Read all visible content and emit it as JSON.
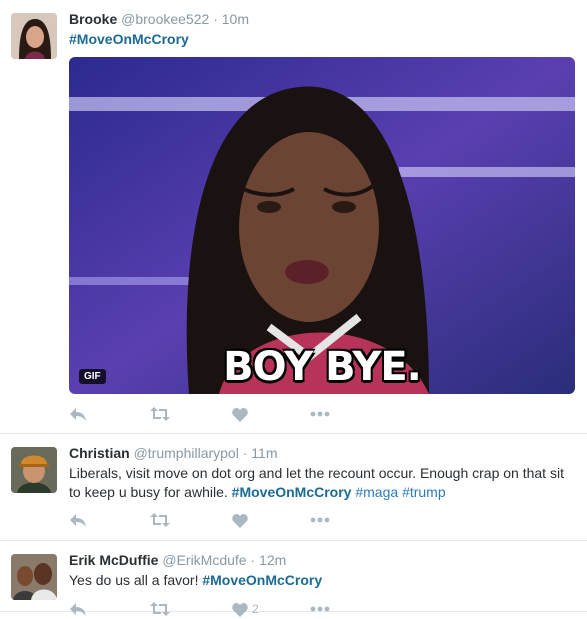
{
  "colors": {
    "link": "#1b6a96",
    "muted": "#8899a6",
    "icon": "#aab8c2",
    "border": "#e1e8ed"
  },
  "icons": [
    "reply-icon",
    "retweet-icon",
    "like-icon",
    "more-icon"
  ],
  "tweets": [
    {
      "fullname": "Brooke",
      "username": "@brookee522",
      "dot": "·",
      "time": "10m",
      "text": [
        {
          "hashtag": "#MoveOnMcCrory"
        }
      ],
      "media": {
        "badge": "GIF",
        "caption": "BOY BYE."
      }
    },
    {
      "fullname": "Christian",
      "username": "@trumphillarypol",
      "dot": "·",
      "time": "11m",
      "text_plain": "Liberals, visit move on dot org and let the recount occur.  Enough crap on that sit to keep u busy for awhile.",
      "hashtags": [
        "#MoveOnMcCrory",
        "#maga",
        "#trump"
      ]
    },
    {
      "fullname": "Erik McDuffie",
      "username": "@ErikMcdufe",
      "dot": "·",
      "time": "12m",
      "text_plain": "Yes do us all a favor!",
      "hashtags": [
        "#MoveOnMcCrory"
      ],
      "like_count": "2"
    }
  ]
}
